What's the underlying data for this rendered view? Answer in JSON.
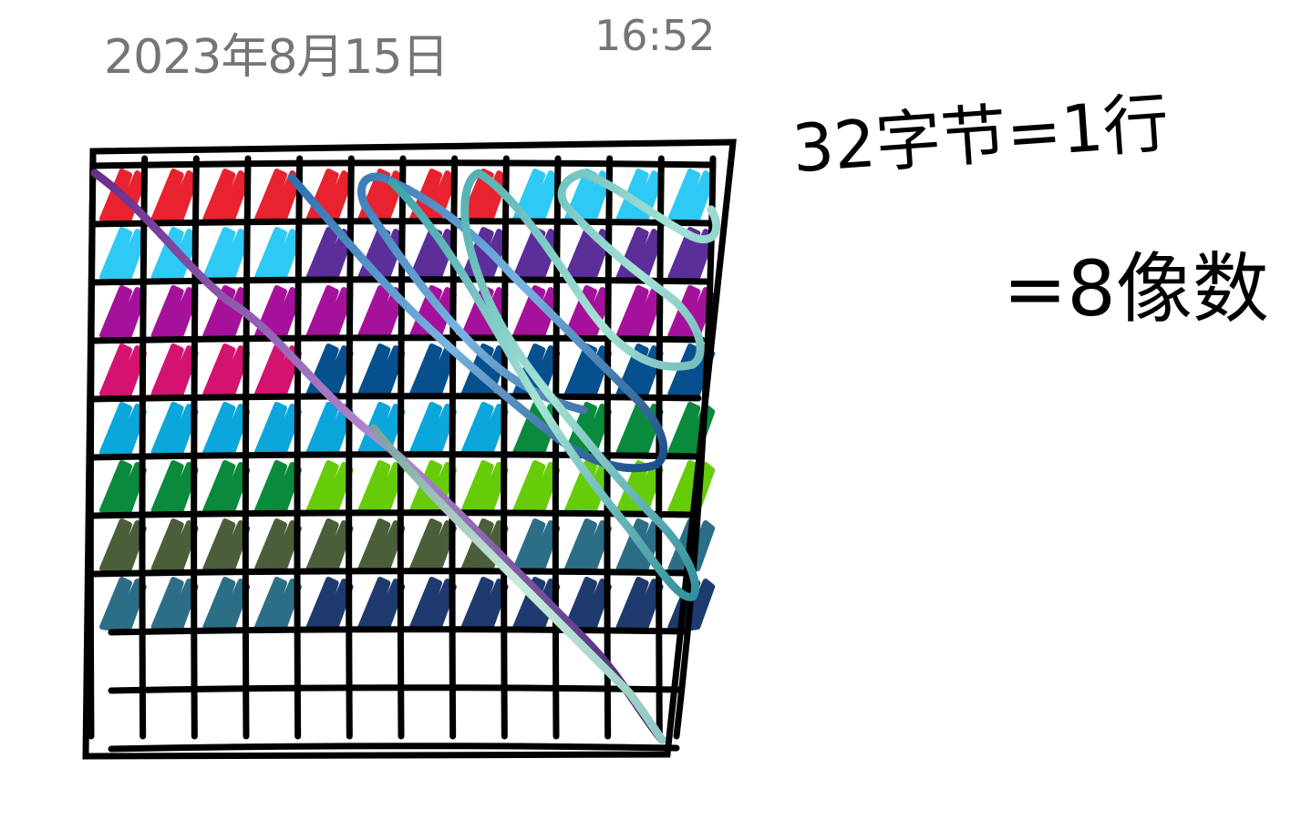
{
  "header": {
    "date": "2023年8月15日",
    "time": "16:52"
  },
  "note": {
    "line1": "32字节=1行",
    "line2": "=8像数"
  },
  "grid": {
    "row_colors": [
      "#e8222e",
      "#2ec9f5",
      "#a5119b",
      "#d4126f",
      "#0aa6dc",
      "#0a8a3c",
      "#4a5e3a",
      "#2c6e86",
      "#ffffff",
      "#ffffff"
    ],
    "row2_second_half": "#5b2e9a",
    "row4_second_half": "#07508e",
    "row5_second_half": "#0a8a3c",
    "row6_second_half": "#66cc0a",
    "row7_second_half": "#2c6e86",
    "row8_second_half": "#1f3a6e"
  },
  "colors": {
    "stroke": "#000000",
    "header_text": "#757575"
  }
}
